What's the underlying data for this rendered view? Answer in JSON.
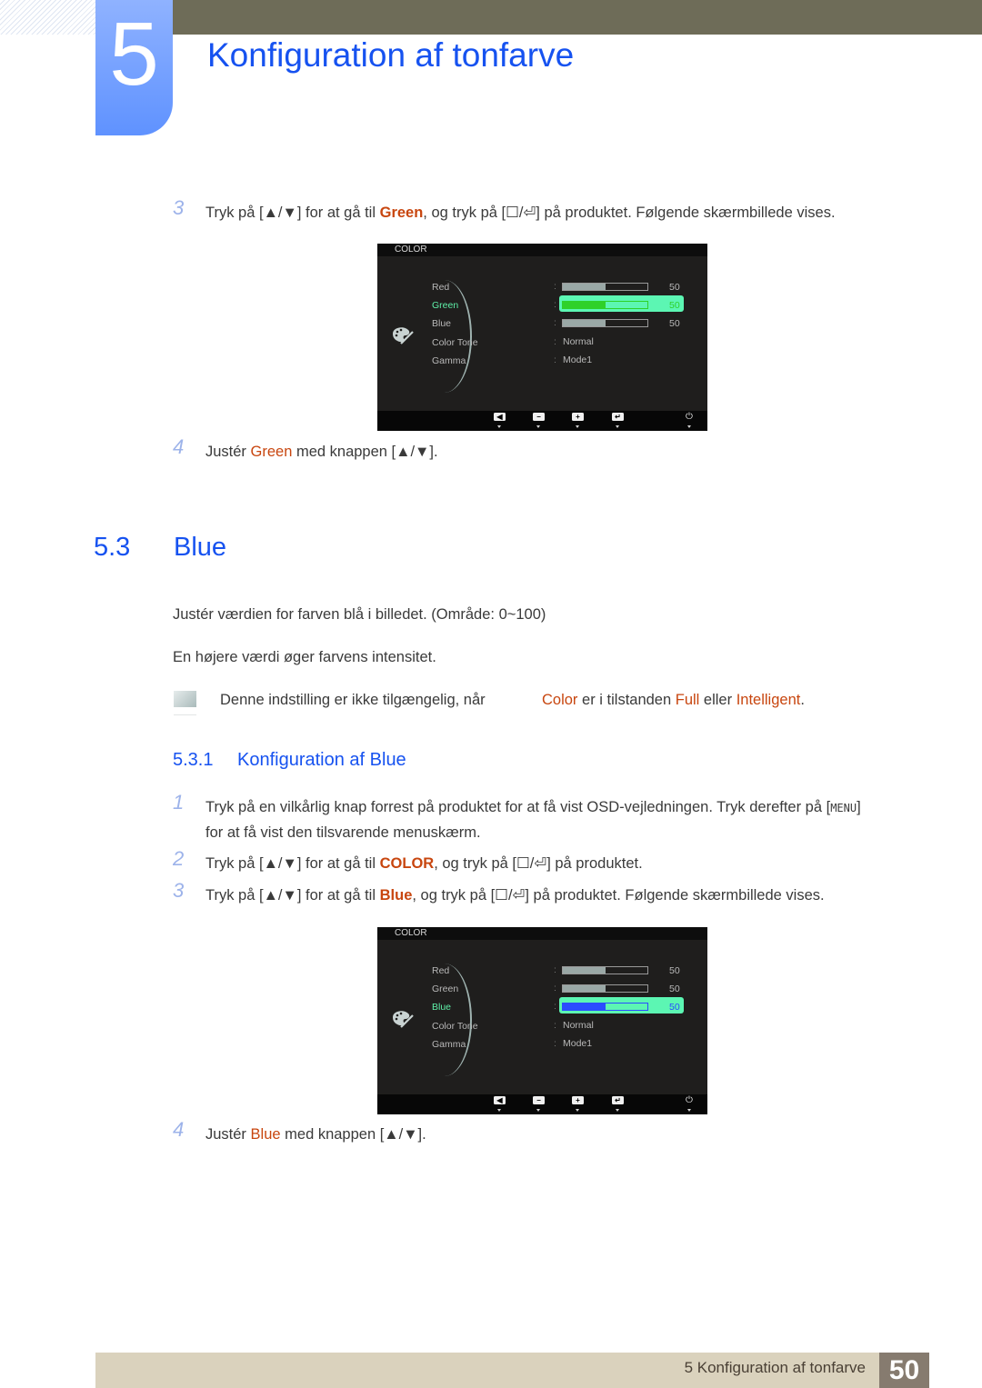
{
  "chapter": {
    "number": "5",
    "title": "Konfiguration af tonfarve"
  },
  "green_steps": {
    "step3": {
      "num": "3",
      "pre": "Tryk på [▲/▼] for at gå til ",
      "hl": "Green",
      "post": ", og tryk på [☐/⏎] på produktet. Følgende skærmbillede vises."
    },
    "step4": {
      "num": "4",
      "pre": "Justér ",
      "hl": "Green",
      "post": " med knappen [▲/▼]."
    }
  },
  "osd_green": {
    "header": "COLOR",
    "selected": "Green",
    "accent_color": "#2fd12a",
    "rows": [
      {
        "label": "Red",
        "type": "bar",
        "value": 50
      },
      {
        "label": "Green",
        "type": "bar",
        "value": 50
      },
      {
        "label": "Blue",
        "type": "bar",
        "value": 50
      },
      {
        "label": "Color Tone",
        "type": "text",
        "value": "Normal"
      },
      {
        "label": "Gamma",
        "type": "text",
        "value": "Mode1"
      }
    ],
    "colon": ":",
    "buttons": [
      "◀",
      "−",
      "+",
      "↵"
    ],
    "power": "⏻"
  },
  "section": {
    "number": "5.3",
    "title": "Blue",
    "para1": "Justér værdien for farven blå i billedet. (Område: 0~100)",
    "para2": "En højere værdi øger farvens intensitet.",
    "note": {
      "pre": "Denne indstilling er ikke tilgængelig, når",
      "hl1": "Color",
      "mid1": " er i tilstanden ",
      "hl2": "Full",
      "mid2": " eller ",
      "hl3": "Intelligent",
      "end": "."
    }
  },
  "subsection": {
    "number": "5.3.1",
    "title": "Konfiguration af Blue",
    "step1": {
      "num": "1",
      "line1_pre": "Tryk på en vilkårlig knap forrest på produktet for at få vist OSD-vejledningen. Tryk derefter på [",
      "key": "MENU",
      "line1_post": "]",
      "line2": "for at få vist den tilsvarende menuskærm."
    },
    "step2": {
      "num": "2",
      "pre": "Tryk på [▲/▼] for at gå til ",
      "hl": "COLOR",
      "post": ", og tryk på [☐/⏎] på produktet."
    },
    "step3": {
      "num": "3",
      "pre": "Tryk på [▲/▼] for at gå til ",
      "hl": "Blue",
      "post": ", og tryk på [☐/⏎] på produktet. Følgende skærmbillede vises."
    },
    "step4": {
      "num": "4",
      "pre": "Justér ",
      "hl": "Blue",
      "post": " med knappen [▲/▼]."
    }
  },
  "osd_blue": {
    "header": "COLOR",
    "selected": "Blue",
    "accent_color": "#2b4cff",
    "rows": [
      {
        "label": "Red",
        "type": "bar",
        "value": 50
      },
      {
        "label": "Green",
        "type": "bar",
        "value": 50
      },
      {
        "label": "Blue",
        "type": "bar",
        "value": 50
      },
      {
        "label": "Color Tone",
        "type": "text",
        "value": "Normal"
      },
      {
        "label": "Gamma",
        "type": "text",
        "value": "Mode1"
      }
    ],
    "colon": ":",
    "buttons": [
      "◀",
      "−",
      "+",
      "↵"
    ],
    "power": "⏻"
  },
  "footer": {
    "chapter_label": "5 Konfiguration af tonfarve",
    "page": "50"
  }
}
